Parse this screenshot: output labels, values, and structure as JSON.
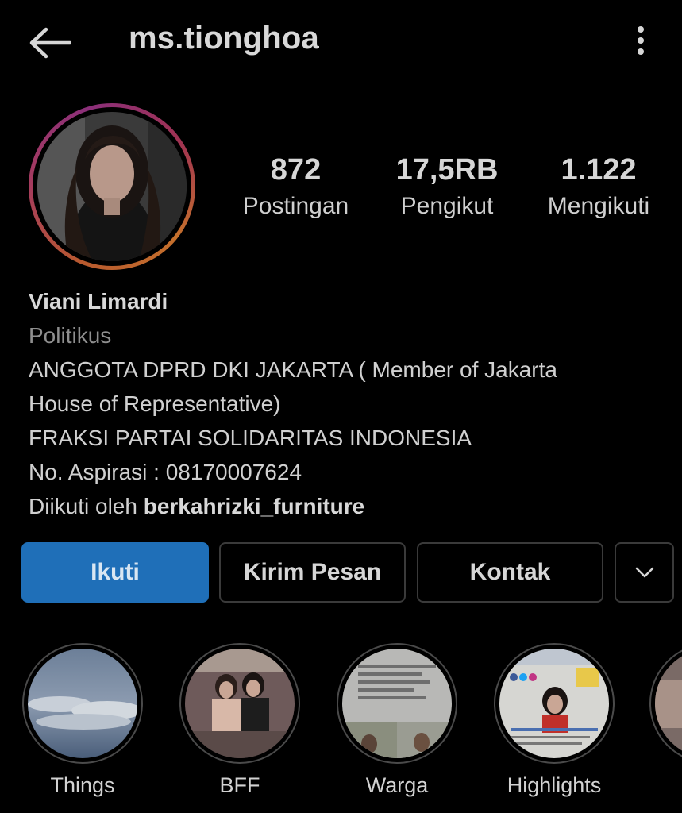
{
  "header": {
    "username": "ms.tionghoa",
    "back_icon": "arrow-left-icon",
    "more_icon": "more-vertical-icon"
  },
  "stats": [
    {
      "value": "872",
      "label": "Postingan"
    },
    {
      "value": "17,5RB",
      "label": "Pengikut"
    },
    {
      "value": "1.122",
      "label": "Mengikuti"
    }
  ],
  "bio": {
    "name": "Viani Limardi",
    "category": "Politikus",
    "line1": "ANGGOTA DPRD DKI JAKARTA ( Member of Jakarta",
    "line2": "House of Representative)",
    "line3": "FRAKSI PARTAI SOLIDARITAS INDONESIA",
    "line4": "No. Aspirasi : 08170007624",
    "followed_by_prefix": "Diikuti oleh ",
    "followed_by_user": "berkahrizki_furniture"
  },
  "actions": {
    "follow": "Ikuti",
    "message": "Kirim Pesan",
    "contact": "Kontak",
    "dropdown_icon": "chevron-down-icon"
  },
  "highlights": [
    {
      "label": "Things"
    },
    {
      "label": "BFF"
    },
    {
      "label": "Warga"
    },
    {
      "label": "Highlights"
    },
    {
      "label": ""
    }
  ],
  "colors": {
    "background": "#000000",
    "accent": "#1f6fb8"
  }
}
